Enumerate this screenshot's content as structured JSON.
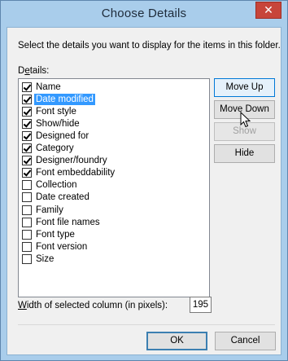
{
  "window": {
    "title": "Choose Details",
    "close_glyph": "✕"
  },
  "description": "Select the details you want to display for the items in this folder.",
  "details_label_prefix": "D",
  "details_label_accel": "e",
  "details_label_suffix": "tails:",
  "items": [
    {
      "label": "Name",
      "checked": true
    },
    {
      "label": "Date modified",
      "checked": true,
      "selected": true
    },
    {
      "label": "Font style",
      "checked": true
    },
    {
      "label": "Show/hide",
      "checked": true
    },
    {
      "label": "Designed for",
      "checked": true
    },
    {
      "label": "Category",
      "checked": true
    },
    {
      "label": "Designer/foundry",
      "checked": true
    },
    {
      "label": "Font embeddability",
      "checked": true
    },
    {
      "label": "Collection",
      "checked": false
    },
    {
      "label": "Date created",
      "checked": false
    },
    {
      "label": "Family",
      "checked": false
    },
    {
      "label": "Font file names",
      "checked": false
    },
    {
      "label": "Font type",
      "checked": false
    },
    {
      "label": "Font version",
      "checked": false
    },
    {
      "label": "Size",
      "checked": false
    }
  ],
  "buttons": {
    "move_up": "Move Up",
    "move_down": "Move Down",
    "show": "Show",
    "hide": "Hide",
    "ok": "OK",
    "cancel": "Cancel"
  },
  "width": {
    "label_accel": "W",
    "label_rest": "idth of selected column (in pixels):",
    "value": "195"
  },
  "colors": {
    "titlebar": "#a9cdeb",
    "close": "#c7453a",
    "selection": "#3399ff"
  }
}
